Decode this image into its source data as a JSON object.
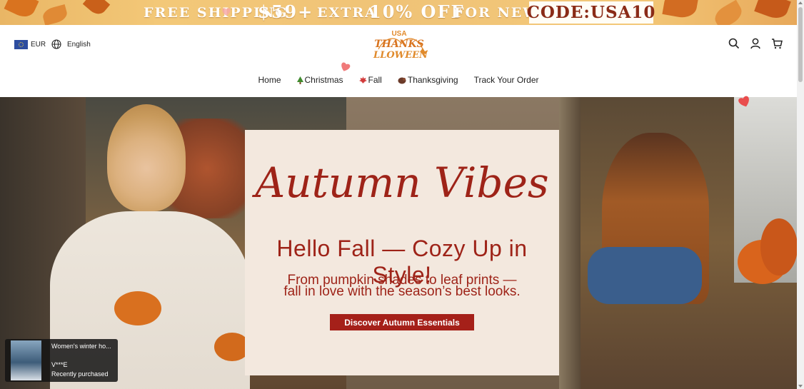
{
  "announcement": {
    "free_shipping": "FREE SHIPPING",
    "threshold": "$59+",
    "extra": "EXTRA",
    "discount": "10% OFF",
    "for_new": "FOR NEW",
    "code": "CODE:USA10"
  },
  "header": {
    "currency": "EUR",
    "language": "English",
    "logo": {
      "line1": "USA",
      "line2": "THANKS",
      "line3": "LLOWEEN"
    }
  },
  "nav": {
    "items": [
      {
        "label": "Home",
        "icon": ""
      },
      {
        "label": "Christmas",
        "icon": "christmas-tree-icon"
      },
      {
        "label": "Fall",
        "icon": "maple-leaf-icon"
      },
      {
        "label": "Thanksgiving",
        "icon": "turkey-icon"
      },
      {
        "label": "Track Your Order",
        "icon": ""
      }
    ]
  },
  "hero": {
    "script_title": "Autumn Vibes",
    "headline": "Hello Fall — Cozy Up in Style!",
    "subline1": "From pumpkin shades to leaf prints —",
    "subline2": "fall in love with the season’s best looks.",
    "cta": "Discover Autumn Essentials"
  },
  "toast": {
    "product": "Women's winter ho...",
    "user": "V***E",
    "status": "Recently purchased"
  },
  "colors": {
    "accent": "#a52019",
    "headline": "#9e2318",
    "promo_bg": "#f3e8de",
    "banner": "#f0c377"
  }
}
